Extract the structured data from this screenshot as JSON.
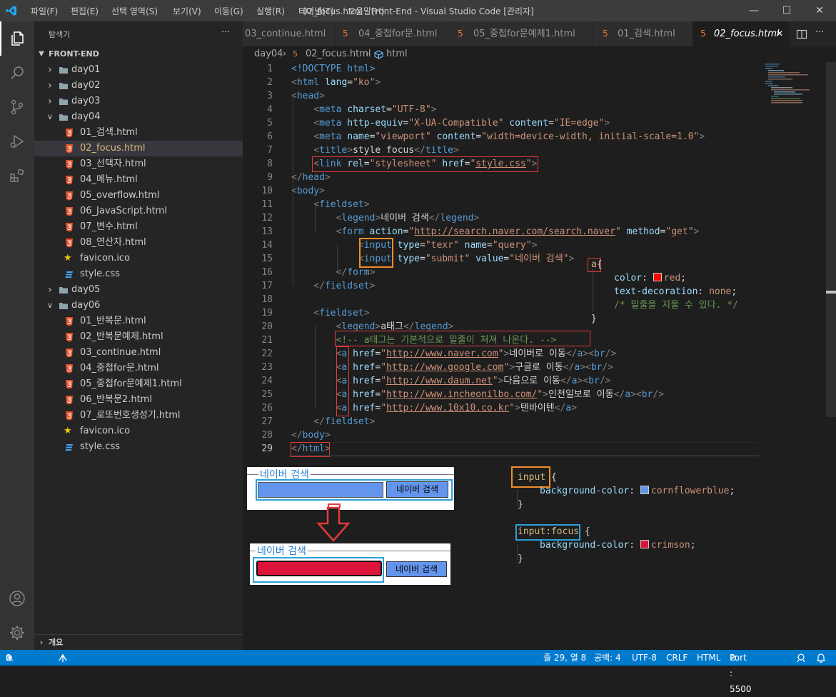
{
  "titlebar": {
    "menus": [
      "파일(F)",
      "편집(E)",
      "선택 영역(S)",
      "보기(V)",
      "이동(G)",
      "실행(R)",
      "터미널(T)",
      "도움말(H)"
    ],
    "title": "02_focus.html - Front-End - Visual Studio Code [관리자]",
    "minimize": "—",
    "maximize": "☐",
    "close": "✕"
  },
  "explorer": {
    "header": "탐색기",
    "more": "···",
    "root": "FRONT-END",
    "items": [
      {
        "label": "day01",
        "type": "folder"
      },
      {
        "label": "day02",
        "type": "folder"
      },
      {
        "label": "day03",
        "type": "folder"
      },
      {
        "label": "day04",
        "type": "folder-open"
      },
      {
        "label": "01_검색.html",
        "type": "html"
      },
      {
        "label": "02_focus.html",
        "type": "html"
      },
      {
        "label": "03_선택자.html",
        "type": "html"
      },
      {
        "label": "04_메뉴.html",
        "type": "html"
      },
      {
        "label": "05_overflow.html",
        "type": "html"
      },
      {
        "label": "06_JavaScript.html",
        "type": "html"
      },
      {
        "label": "07_변수.html",
        "type": "html"
      },
      {
        "label": "08_연산자.html",
        "type": "html"
      },
      {
        "label": "favicon.ico",
        "type": "ico"
      },
      {
        "label": "style.css",
        "type": "css"
      },
      {
        "label": "day05",
        "type": "folder"
      },
      {
        "label": "day06",
        "type": "folder-open"
      },
      {
        "label": "01_반복문.html",
        "type": "html"
      },
      {
        "label": "02_반복문예제.html",
        "type": "html"
      },
      {
        "label": "03_continue.html",
        "type": "html"
      },
      {
        "label": "04_중첩for문.html",
        "type": "html"
      },
      {
        "label": "05_중첩for문예제1.html",
        "type": "html"
      },
      {
        "label": "06_반복문2.html",
        "type": "html"
      },
      {
        "label": "07_로또번호생성기.html",
        "type": "html"
      },
      {
        "label": "favicon.ico",
        "type": "ico"
      },
      {
        "label": "style.css",
        "type": "css"
      }
    ],
    "outline": "개요"
  },
  "tabs": [
    {
      "label": "03_continue.html"
    },
    {
      "label": "04_중첩for문.html"
    },
    {
      "label": "05_중첩for문예제1.html"
    },
    {
      "label": "01_검색.html"
    },
    {
      "label": "02_focus.html"
    }
  ],
  "tab_close": "✕",
  "breadcrumb": {
    "folder": "day04",
    "file": "02_focus.html",
    "symbol": "html",
    "sep": "›"
  },
  "line_numbers": [
    "1",
    "2",
    "3",
    "4",
    "5",
    "6",
    "7",
    "8",
    "9",
    "10",
    "11",
    "12",
    "13",
    "14",
    "15",
    "16",
    "17",
    "18",
    "19",
    "20",
    "21",
    "22",
    "23",
    "24",
    "25",
    "26",
    "27",
    "28",
    "29"
  ],
  "code": {
    "l1": [
      "<!DOCTYPE ",
      "html",
      ">"
    ],
    "l2": [
      "<",
      "html",
      " lang",
      "=",
      "\"ko\"",
      ">"
    ],
    "l3": [
      "<",
      "head",
      ">"
    ],
    "l4": [
      "<",
      "meta",
      " charset",
      "=",
      "\"UTF-8\"",
      ">"
    ],
    "l5": [
      "<",
      "meta",
      " http-equiv",
      "=",
      "\"X-UA-Compatible\"",
      " content",
      "=",
      "\"IE=edge\"",
      ">"
    ],
    "l6": [
      "<",
      "meta",
      " name",
      "=",
      "\"viewport\"",
      " content",
      "=",
      "\"width=device-width, initial-scale=1.0\"",
      ">"
    ],
    "l7": [
      "<",
      "title",
      ">",
      "style focus",
      "</",
      "title",
      ">"
    ],
    "l8": [
      "<",
      "link",
      " rel",
      "=",
      "\"stylesheet\"",
      " href",
      "=",
      "\"",
      "style.css",
      "\"",
      ">"
    ],
    "l9": [
      "</",
      "head",
      ">"
    ],
    "l10": [
      "<",
      "body",
      ">"
    ],
    "l11": [
      "<",
      "fieldset",
      ">"
    ],
    "l12": [
      "<",
      "legend",
      ">",
      "네이버 검색",
      "</",
      "legend",
      ">"
    ],
    "l13": [
      "<",
      "form",
      " action",
      "=",
      "\"",
      "http://search.naver.com/search.naver",
      "\"",
      " method",
      "=",
      "\"get\"",
      ">"
    ],
    "l14": [
      "<",
      "input",
      " type",
      "=",
      "\"texr\"",
      " name",
      "=",
      "\"query\"",
      ">"
    ],
    "l15": [
      "<",
      "input",
      " type",
      "=",
      "\"submit\"",
      " value",
      "=",
      "\"네이버 검색\"",
      ">"
    ],
    "l16": [
      "</",
      "form",
      ">"
    ],
    "l17": [
      "</",
      "fieldset",
      ">"
    ],
    "l19": [
      "<",
      "fieldset",
      ">"
    ],
    "l20": [
      "<",
      "legend",
      ">",
      "a태그",
      "</",
      "legend",
      ">"
    ],
    "l21": [
      "<!-- a태그는 기본적으로 밑줄이 쳐져 나온다. -->"
    ],
    "l22": [
      "<",
      "a",
      " href",
      "=",
      "\"",
      "http://www.naver.com",
      "\"",
      ">",
      "네이버로 이동",
      "</",
      "a",
      "><",
      "br",
      "/>"
    ],
    "l23": [
      "<",
      "a",
      " href",
      "=",
      "\"",
      "http://www.google.com",
      "\"",
      ">",
      "구글로 이동",
      "</",
      "a",
      "><",
      "br",
      "/>"
    ],
    "l24": [
      "<",
      "a",
      " href",
      "=",
      "\"",
      "http://www.daum.net",
      "\"",
      ">",
      "다음으로 이동",
      "</",
      "a",
      "><",
      "br",
      "/>"
    ],
    "l25": [
      "<",
      "a",
      " href",
      "=",
      "\"",
      "http://www.incheonilbo.com/",
      "\"",
      ">",
      "인천일보로 이동",
      "</",
      "a",
      "><",
      "br",
      "/>"
    ],
    "l26": [
      "<",
      "a",
      " href",
      "=",
      "\"",
      "http://www.10x10.co.kr",
      "\"",
      ">",
      "텐바이텐",
      "</",
      "a",
      ">"
    ],
    "l27": [
      "</",
      "fieldset",
      ">"
    ],
    "l28": [
      "</",
      "body",
      ">"
    ],
    "l29": [
      "</",
      "html",
      ">"
    ]
  },
  "css_a": {
    "selector": "a",
    "open": "{",
    "p1": "color",
    "v1": "red",
    "v1_color": "#ff0000",
    "p2": "text-decoration",
    "v2": "none",
    "comment": "/* 밑줄을 지울 수 있다. */",
    "close": "}",
    "colon": ":",
    "semi": ";"
  },
  "css_input": {
    "selector": "input",
    "open": "{",
    "p1": "background-color",
    "v1": "cornflowerblue",
    "v1_color": "#6495ed",
    "close": "}",
    "colon": ":",
    "semi": ";"
  },
  "css_focus": {
    "selector": "input:focus",
    "open": "{",
    "p1": "background-color",
    "v1": "crimson",
    "v1_color": "#dc143c",
    "close": "}",
    "colon": ":",
    "semi": ";"
  },
  "preview": {
    "legend": "네이버 검색",
    "button": "네이버 검색",
    "normal_color": "#6495ed",
    "focus_color": "#dc143c"
  },
  "status": {
    "errors": "0",
    "warnings": "0",
    "position": "줄 29, 열 8",
    "spaces": "공백: 4",
    "encoding": "UTF-8",
    "eol": "CRLF",
    "language": "HTML",
    "port": "Port : 5500"
  }
}
